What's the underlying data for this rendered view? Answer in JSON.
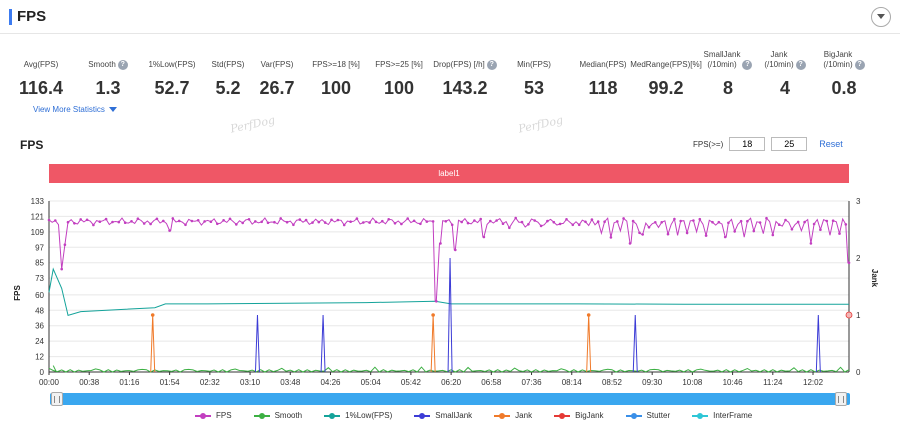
{
  "header": {
    "title": "FPS"
  },
  "stats": [
    {
      "label": "Avg(FPS)",
      "value": "116.4",
      "help": false
    },
    {
      "label": "Smooth",
      "value": "1.3",
      "help": true
    },
    {
      "label": "1%Low(FPS)",
      "value": "52.7",
      "help": false
    },
    {
      "label": "Std(FPS)",
      "value": "5.2",
      "help": false
    },
    {
      "label": "Var(FPS)",
      "value": "26.7",
      "help": false
    },
    {
      "label": "FPS>=18 [%]",
      "value": "100",
      "help": false
    },
    {
      "label": "FPS>=25 [%]",
      "value": "100",
      "help": false
    },
    {
      "label": "Drop(FPS) [/h]",
      "value": "143.2",
      "help": true
    },
    {
      "label": "Min(FPS)",
      "value": "53",
      "help": false
    },
    {
      "label": "Median(FPS)",
      "value": "118",
      "help": false
    },
    {
      "label": "MedRange(FPS)[%]",
      "value": "99.2",
      "help": false
    },
    {
      "label": "SmallJank\n(/10min)",
      "value": "8",
      "help": true
    },
    {
      "label": "Jank\n(/10min)",
      "value": "4",
      "help": true
    },
    {
      "label": "BigJank\n(/10min)",
      "value": "0.8",
      "help": true
    }
  ],
  "more_stats": "View More Statistics",
  "watermark": "PerfDog",
  "chart_section": {
    "title": "FPS",
    "filter_label": "FPS(>=)",
    "filter_values": [
      "18",
      "25"
    ],
    "reset": "Reset",
    "label_bar": "label1"
  },
  "colors": {
    "fps": "#c23fc0",
    "smooth": "#3cb043",
    "low": "#14a39a",
    "smalljank": "#3c3cd6",
    "jank": "#f07a2a",
    "bigjank": "#e53935",
    "stutter": "#3a8fe8",
    "interframe": "#2ec6d6",
    "label_bar": "#ef5766"
  },
  "chart_data": {
    "type": "line",
    "ylabel": "FPS",
    "y2label": "Jank",
    "yticks": [
      0,
      12,
      24,
      36,
      48,
      60,
      73,
      85,
      97,
      109,
      121,
      133
    ],
    "ylim": [
      0,
      133
    ],
    "y2ticks": [
      0,
      1,
      2,
      3
    ],
    "y2lim": [
      0,
      3
    ],
    "xticks": [
      "00:00",
      "00:38",
      "01:16",
      "01:54",
      "02:32",
      "03:10",
      "03:48",
      "04:26",
      "05:04",
      "05:42",
      "06:20",
      "06:58",
      "07:36",
      "08:14",
      "08:52",
      "09:30",
      "10:08",
      "10:46",
      "11:24",
      "12:02"
    ],
    "x_unit": "seconds",
    "x_max": 756,
    "grid": true,
    "legend_placement": "bottom",
    "series": [
      {
        "name": "FPS",
        "baseline": 117,
        "dips": [
          [
            12,
            80
          ],
          [
            15,
            99
          ],
          [
            115,
            110
          ],
          [
            365,
            55
          ],
          [
            370,
            100
          ],
          [
            383,
            95
          ],
          [
            410,
            105
          ],
          [
            550,
            100
          ],
          [
            560,
            107
          ],
          [
            640,
            105
          ],
          [
            720,
            100
          ],
          [
            755,
            85
          ]
        ]
      },
      {
        "name": "Smooth"
      },
      {
        "name": "1%Low(FPS)",
        "x": [
          0,
          4,
          12,
          18,
          30,
          100,
          110,
          150,
          300,
          365,
          380,
          500,
          600,
          700,
          756
        ],
        "y": [
          62,
          80,
          65,
          44,
          47,
          50,
          53,
          53,
          54,
          55,
          53,
          53,
          52.7,
          52.7,
          52.7
        ]
      },
      {
        "name": "SmallJank",
        "spikes": [
          [
            197,
            1
          ],
          [
            259,
            1
          ],
          [
            379,
            2
          ],
          [
            554,
            1
          ],
          [
            727,
            1
          ]
        ]
      },
      {
        "name": "Jank",
        "spikes": [
          [
            98,
            1
          ],
          [
            363,
            1
          ],
          [
            510,
            1
          ]
        ]
      },
      {
        "name": "BigJank"
      },
      {
        "name": "Stutter"
      },
      {
        "name": "InterFrame"
      }
    ]
  }
}
